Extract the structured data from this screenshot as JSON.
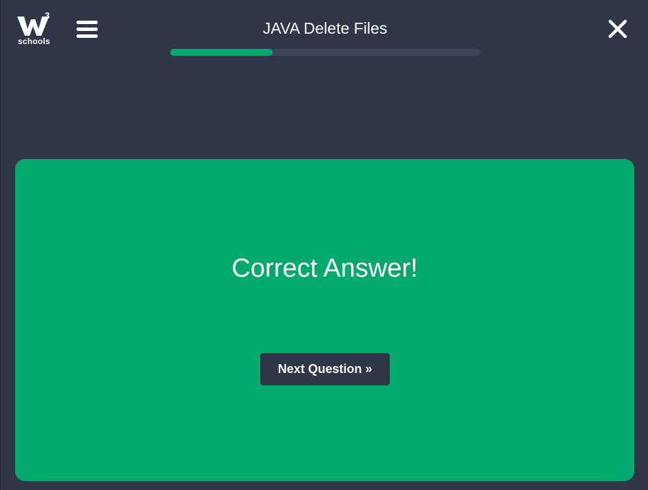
{
  "logo": {
    "superscript": "3",
    "wordmark": "schools",
    "icon": "w3schools-logo-icon"
  },
  "header": {
    "menu_icon": "hamburger-menu-icon",
    "title": "JAVA Delete Files",
    "close_icon": "close-icon"
  },
  "progress": {
    "fraction": 0.33,
    "fill_color": "#04aa6d",
    "track_color": "#3d4558"
  },
  "result": {
    "message": "Correct Answer!",
    "next_button_label": "Next Question »",
    "card_color": "#04aa6d"
  },
  "colors": {
    "background": "#2f3648",
    "accent": "#04aa6d",
    "text": "#ffffff"
  }
}
